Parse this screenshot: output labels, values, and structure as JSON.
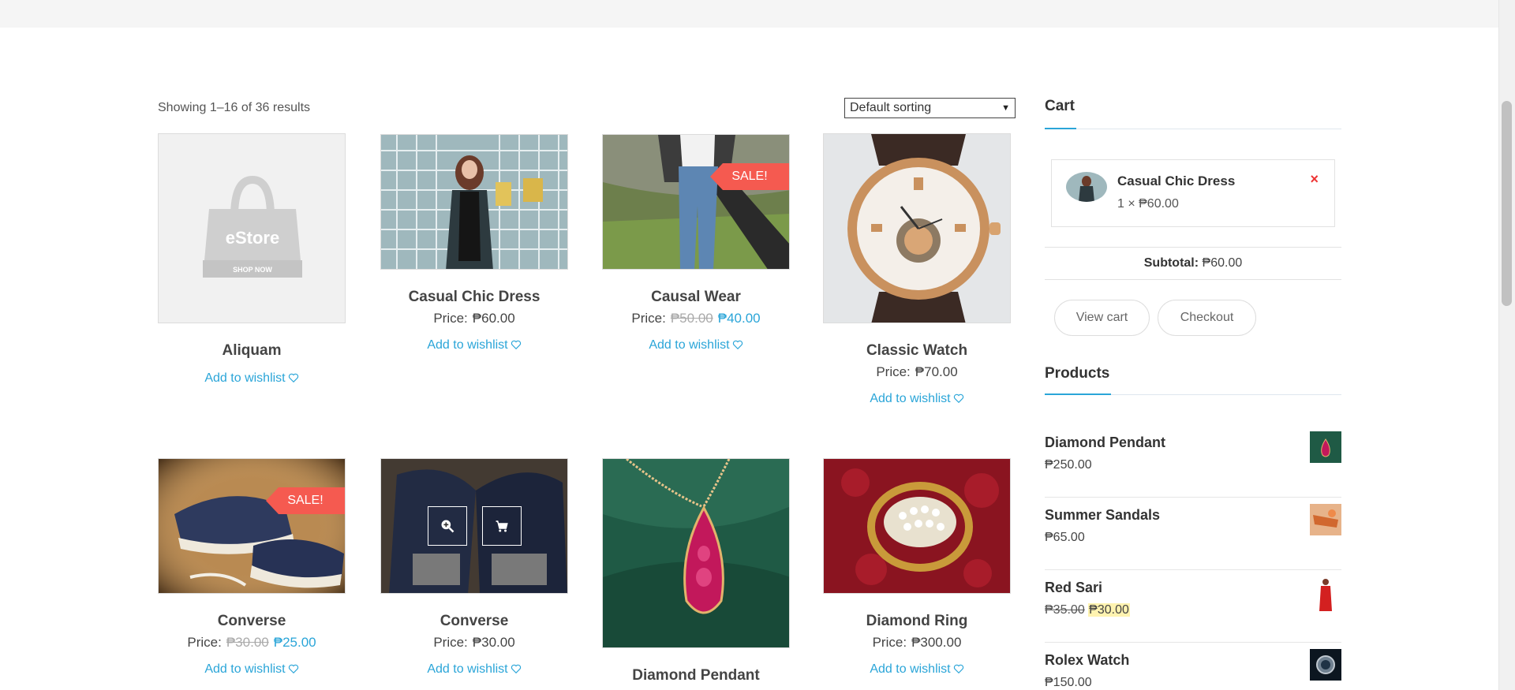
{
  "shop": {
    "result_count": "Showing 1–16 of 36 results",
    "sorting_selected": "Default sorting"
  },
  "products": [
    {
      "title": "Aliquam",
      "price_label": "",
      "regular_price": "",
      "sale_price": "",
      "wishlist": "Add to wishlist",
      "on_sale": false,
      "placeholder_brand": "eStore",
      "placeholder_cta": "SHOP NOW"
    },
    {
      "title": "Casual Chic Dress",
      "price_label": "Price:",
      "regular_price": "₱60.00",
      "sale_price": "",
      "wishlist": "Add to wishlist",
      "on_sale": false
    },
    {
      "title": "Causal Wear",
      "price_label": "Price:",
      "regular_price": "₱50.00",
      "sale_price": "₱40.00",
      "wishlist": "Add to wishlist",
      "on_sale": true,
      "badge": "SALE!"
    },
    {
      "title": "Classic Watch",
      "price_label": "Price:",
      "regular_price": "₱70.00",
      "sale_price": "",
      "wishlist": "Add to wishlist",
      "on_sale": false
    },
    {
      "title": "Converse",
      "price_label": "Price:",
      "regular_price": "₱30.00",
      "sale_price": "₱25.00",
      "wishlist": "Add to wishlist",
      "on_sale": true,
      "badge": "SALE!"
    },
    {
      "title": "Converse",
      "price_label": "Price:",
      "regular_price": "₱30.00",
      "sale_price": "",
      "wishlist": "Add to wishlist",
      "on_sale": false,
      "hover_actions": [
        "zoom-icon",
        "cart-icon"
      ]
    },
    {
      "title": "Diamond Pendant",
      "price_label": "",
      "regular_price": "",
      "sale_price": "",
      "wishlist": "",
      "on_sale": false
    },
    {
      "title": "Diamond Ring",
      "price_label": "Price:",
      "regular_price": "₱300.00",
      "sale_price": "",
      "wishlist": "Add to wishlist",
      "on_sale": false
    }
  ],
  "sidebar": {
    "cart": {
      "title": "Cart",
      "item_name": "Casual Chic Dress",
      "item_qty": "1 × ₱60.00",
      "remove_symbol": "×",
      "subtotal_label": "Subtotal:",
      "subtotal_value": "₱60.00",
      "view_cart": "View cart",
      "checkout": "Checkout"
    },
    "products_widget": {
      "title": "Products",
      "items": [
        {
          "name": "Diamond Pendant",
          "price": "₱250.00"
        },
        {
          "name": "Summer Sandals",
          "price": "₱65.00"
        },
        {
          "name": "Red Sari",
          "regular_price": "₱35.00",
          "sale_price": "₱30.00"
        },
        {
          "name": "Rolex Watch",
          "price": "₱150.00"
        }
      ]
    }
  },
  "colors": {
    "accent": "#2aa5d8",
    "sale_badge": "#f55a50",
    "remove": "#e33333"
  }
}
